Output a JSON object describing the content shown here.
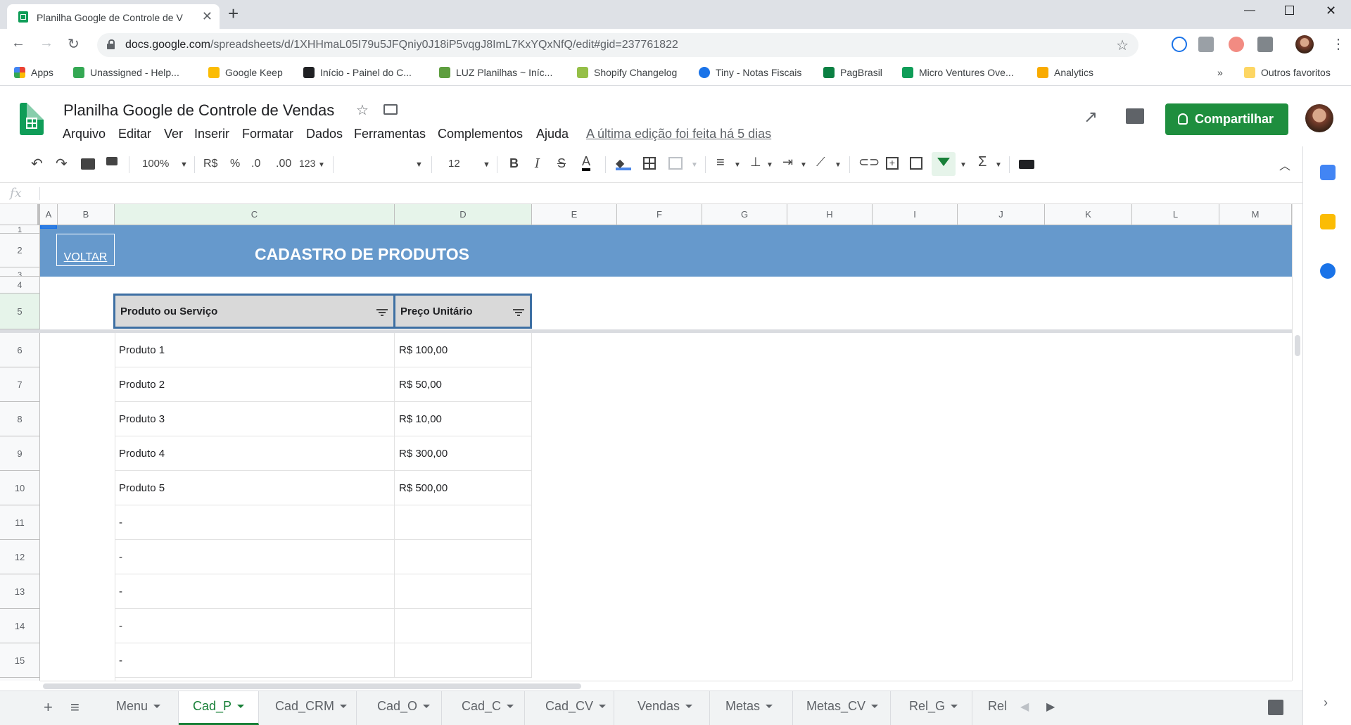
{
  "browser": {
    "tab_title": "Planilha Google de Controle de V",
    "url_host": "docs.google.com",
    "url_path": "/spreadsheets/d/1XHHmaL05I79u5JFQniy0J18iP5vqgJ8ImL7KxYQxNfQ/edit#gid=237761822",
    "bookmarks": [
      "Apps",
      "Unassigned - Help...",
      "Google Keep",
      "Início - Painel do C...",
      "LUZ Planilhas ~ Iníc...",
      "Shopify Changelog",
      "Tiny - Notas Fiscais",
      "PagBrasil",
      "Micro Ventures Ove...",
      "Analytics",
      "Outros favoritos"
    ],
    "bookmarks_more": "»"
  },
  "doc": {
    "title": "Planilha Google de Controle de Vendas",
    "menus": [
      "Arquivo",
      "Editar",
      "Ver",
      "Inserir",
      "Formatar",
      "Dados",
      "Ferramentas",
      "Complementos",
      "Ajuda"
    ],
    "last_edit": "A última edição foi feita há 5 dias",
    "share_label": "Compartilhar"
  },
  "toolbar": {
    "zoom": "100%",
    "currency": "R$",
    "percent": "%",
    "dec_less": ".0",
    "dec_more": ".00",
    "format_more": "123",
    "font_size": "12"
  },
  "formula_bar": {
    "fx": "fx",
    "value": ""
  },
  "grid": {
    "columns": [
      "A",
      "B",
      "C",
      "D",
      "E",
      "F",
      "G",
      "H",
      "I",
      "J",
      "K",
      "L",
      "M"
    ],
    "rows": [
      "1",
      "2",
      "3",
      "4",
      "5",
      "6",
      "7",
      "8",
      "9",
      "10",
      "11",
      "12",
      "13",
      "14",
      "15"
    ],
    "voltar": "VOLTAR",
    "banner_title": "CADASTRO DE PRODUTOS",
    "headers": [
      "Produto ou Serviço",
      "Preço Unitário"
    ],
    "products": [
      {
        "name": "Produto 1",
        "price": "R$ 100,00"
      },
      {
        "name": "Produto 2",
        "price": "R$ 50,00"
      },
      {
        "name": "Produto 3",
        "price": "R$ 10,00"
      },
      {
        "name": "Produto 4",
        "price": "R$ 300,00"
      },
      {
        "name": "Produto 5",
        "price": "R$ 500,00"
      },
      {
        "name": "-",
        "price": ""
      },
      {
        "name": "-",
        "price": ""
      },
      {
        "name": "-",
        "price": ""
      },
      {
        "name": "-",
        "price": ""
      },
      {
        "name": "-",
        "price": ""
      }
    ]
  },
  "sheet_tabs": {
    "tabs": [
      "Menu",
      "Cad_P",
      "Cad_CRM",
      "Cad_O",
      "Cad_C",
      "Cad_CV",
      "Vendas",
      "Metas",
      "Metas_CV",
      "Rel_G",
      "Rel"
    ],
    "active": "Cad_P"
  },
  "colors": {
    "banner": "#6699cc",
    "share": "#1e8e3e",
    "active_tab": "#188038",
    "header_cell": "#d9d9d9"
  }
}
